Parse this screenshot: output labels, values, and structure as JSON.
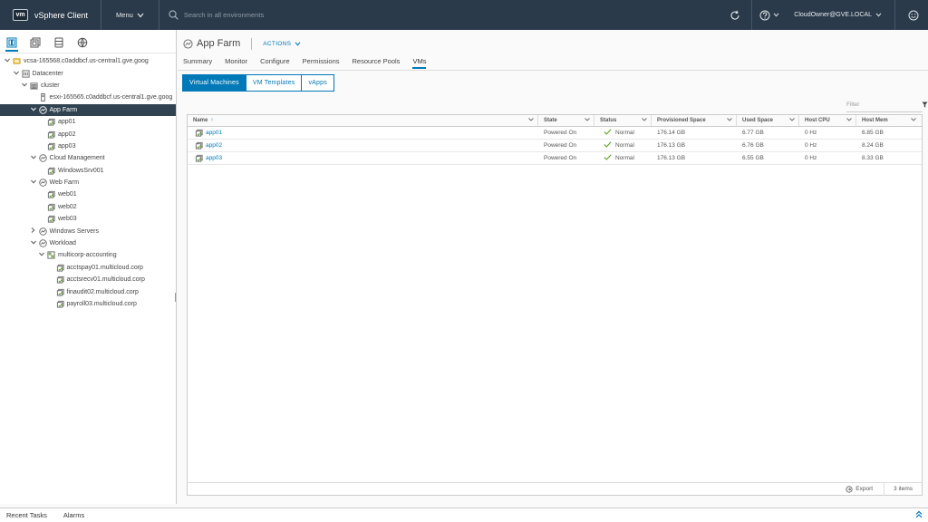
{
  "header": {
    "logo_text": "vm",
    "app_title": "vSphere Client",
    "menu_label": "Menu",
    "search_placeholder": "Search in all environments",
    "user": "CloudOwner@GVE.LOCAL"
  },
  "tree": [
    {
      "label": "vcsa-165568.c0addbcf.us-central1.gve.goog",
      "level": 0,
      "caret": "down",
      "icon": "vcenter-icon"
    },
    {
      "label": "Datacenter",
      "level": 1,
      "caret": "down",
      "icon": "datacenter-icon"
    },
    {
      "label": "cluster",
      "level": 2,
      "caret": "down",
      "icon": "cluster-icon"
    },
    {
      "label": "esxi-165565.c0addbcf.us-central1.gve.goog",
      "level": 3,
      "caret": "none",
      "icon": "host-icon"
    },
    {
      "label": "App Farm",
      "level": 3,
      "caret": "down",
      "icon": "resource-pool-icon",
      "selected": true
    },
    {
      "label": "app01",
      "level": 4,
      "caret": "none",
      "icon": "vm-icon"
    },
    {
      "label": "app02",
      "level": 4,
      "caret": "none",
      "icon": "vm-icon"
    },
    {
      "label": "app03",
      "level": 4,
      "caret": "none",
      "icon": "vm-icon"
    },
    {
      "label": "Cloud Management",
      "level": 3,
      "caret": "down",
      "icon": "resource-pool-icon"
    },
    {
      "label": "WindowsSrv001",
      "level": 4,
      "caret": "none",
      "icon": "vm-icon"
    },
    {
      "label": "Web Farm",
      "level": 3,
      "caret": "down",
      "icon": "resource-pool-icon"
    },
    {
      "label": "web01",
      "level": 4,
      "caret": "none",
      "icon": "vm-icon"
    },
    {
      "label": "web02",
      "level": 4,
      "caret": "none",
      "icon": "vm-icon"
    },
    {
      "label": "web03",
      "level": 4,
      "caret": "none",
      "icon": "vm-icon"
    },
    {
      "label": "Windows Servers",
      "level": 3,
      "caret": "right",
      "icon": "resource-pool-icon"
    },
    {
      "label": "Workload",
      "level": 3,
      "caret": "down",
      "icon": "resource-pool-icon"
    },
    {
      "label": "multicorp-accounting",
      "level": 4,
      "caret": "down",
      "icon": "vapp-icon"
    },
    {
      "label": "acctspay01.multicloud.corp",
      "level": 5,
      "caret": "none",
      "icon": "vm-icon"
    },
    {
      "label": "acctsrecv01.multicloud.corp",
      "level": 5,
      "caret": "none",
      "icon": "vm-icon"
    },
    {
      "label": "finaudit02.multicloud.corp",
      "level": 5,
      "caret": "none",
      "icon": "vm-icon"
    },
    {
      "label": "payroll03.multicloud.corp",
      "level": 5,
      "caret": "none",
      "icon": "vm-icon"
    }
  ],
  "object": {
    "title": "App Farm",
    "actions_label": "ACTIONS"
  },
  "tabs": [
    "Summary",
    "Monitor",
    "Configure",
    "Permissions",
    "Resource Pools",
    "VMs"
  ],
  "active_tab": "VMs",
  "subtabs": [
    "Virtual Machines",
    "VM Templates",
    "vApps"
  ],
  "active_subtab": "Virtual Machines",
  "filter_placeholder": "Filter",
  "table": {
    "columns": [
      "Name",
      "State",
      "Status",
      "Provisioned Space",
      "Used Space",
      "Host CPU",
      "Host Mem"
    ],
    "sort_indicator": "↑",
    "rows": [
      [
        "app01",
        "Powered On",
        "Normal",
        "176.14 GB",
        "6.77 GB",
        "0 Hz",
        "6.85 GB"
      ],
      [
        "app02",
        "Powered On",
        "Normal",
        "176.13 GB",
        "6.76 GB",
        "0 Hz",
        "8.24 GB"
      ],
      [
        "app03",
        "Powered On",
        "Normal",
        "176.13 GB",
        "6.55 GB",
        "0 Hz",
        "8.33 GB"
      ]
    ],
    "export_label": "Export",
    "count_label": "3 items"
  },
  "bottom": {
    "recent_tasks": "Recent Tasks",
    "alarms": "Alarms"
  },
  "colors": {
    "header_bg": "#2b3a4a",
    "accent": "#0079b8",
    "selected_row_bg": "#314351",
    "status_ok": "#5aa220"
  }
}
